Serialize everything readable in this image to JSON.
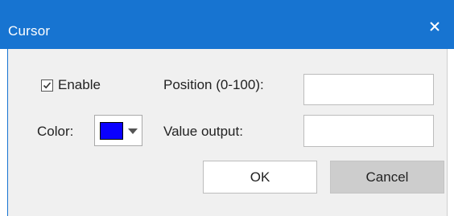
{
  "dialog": {
    "title": "Cursor",
    "close_icon": "close-icon",
    "colors": {
      "titlebar": "#1774d1",
      "content": "#f0f0f0"
    }
  },
  "enable": {
    "label": "Enable",
    "checked": true,
    "icon": "checkmark-icon"
  },
  "position": {
    "label": "Position (0-100):",
    "value": ""
  },
  "color": {
    "label": "Color:",
    "swatch": "#0a00ff",
    "icon": "chevron-down-icon"
  },
  "value_output": {
    "label": "Value output:",
    "value": ""
  },
  "buttons": {
    "ok": "OK",
    "cancel": "Cancel"
  }
}
